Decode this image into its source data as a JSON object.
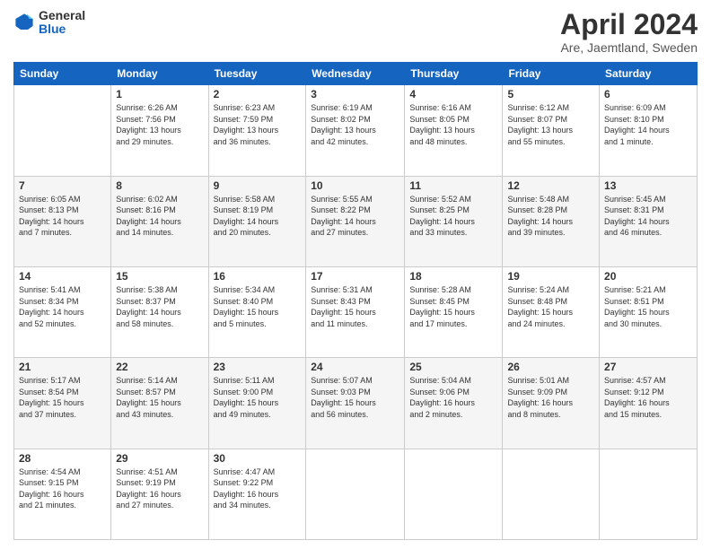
{
  "header": {
    "logo_general": "General",
    "logo_blue": "Blue",
    "month_title": "April 2024",
    "location": "Are, Jaemtland, Sweden"
  },
  "days_of_week": [
    "Sunday",
    "Monday",
    "Tuesday",
    "Wednesday",
    "Thursday",
    "Friday",
    "Saturday"
  ],
  "weeks": [
    [
      {
        "day": "",
        "info": ""
      },
      {
        "day": "1",
        "info": "Sunrise: 6:26 AM\nSunset: 7:56 PM\nDaylight: 13 hours\nand 29 minutes."
      },
      {
        "day": "2",
        "info": "Sunrise: 6:23 AM\nSunset: 7:59 PM\nDaylight: 13 hours\nand 36 minutes."
      },
      {
        "day": "3",
        "info": "Sunrise: 6:19 AM\nSunset: 8:02 PM\nDaylight: 13 hours\nand 42 minutes."
      },
      {
        "day": "4",
        "info": "Sunrise: 6:16 AM\nSunset: 8:05 PM\nDaylight: 13 hours\nand 48 minutes."
      },
      {
        "day": "5",
        "info": "Sunrise: 6:12 AM\nSunset: 8:07 PM\nDaylight: 13 hours\nand 55 minutes."
      },
      {
        "day": "6",
        "info": "Sunrise: 6:09 AM\nSunset: 8:10 PM\nDaylight: 14 hours\nand 1 minute."
      }
    ],
    [
      {
        "day": "7",
        "info": "Sunrise: 6:05 AM\nSunset: 8:13 PM\nDaylight: 14 hours\nand 7 minutes."
      },
      {
        "day": "8",
        "info": "Sunrise: 6:02 AM\nSunset: 8:16 PM\nDaylight: 14 hours\nand 14 minutes."
      },
      {
        "day": "9",
        "info": "Sunrise: 5:58 AM\nSunset: 8:19 PM\nDaylight: 14 hours\nand 20 minutes."
      },
      {
        "day": "10",
        "info": "Sunrise: 5:55 AM\nSunset: 8:22 PM\nDaylight: 14 hours\nand 27 minutes."
      },
      {
        "day": "11",
        "info": "Sunrise: 5:52 AM\nSunset: 8:25 PM\nDaylight: 14 hours\nand 33 minutes."
      },
      {
        "day": "12",
        "info": "Sunrise: 5:48 AM\nSunset: 8:28 PM\nDaylight: 14 hours\nand 39 minutes."
      },
      {
        "day": "13",
        "info": "Sunrise: 5:45 AM\nSunset: 8:31 PM\nDaylight: 14 hours\nand 46 minutes."
      }
    ],
    [
      {
        "day": "14",
        "info": "Sunrise: 5:41 AM\nSunset: 8:34 PM\nDaylight: 14 hours\nand 52 minutes."
      },
      {
        "day": "15",
        "info": "Sunrise: 5:38 AM\nSunset: 8:37 PM\nDaylight: 14 hours\nand 58 minutes."
      },
      {
        "day": "16",
        "info": "Sunrise: 5:34 AM\nSunset: 8:40 PM\nDaylight: 15 hours\nand 5 minutes."
      },
      {
        "day": "17",
        "info": "Sunrise: 5:31 AM\nSunset: 8:43 PM\nDaylight: 15 hours\nand 11 minutes."
      },
      {
        "day": "18",
        "info": "Sunrise: 5:28 AM\nSunset: 8:45 PM\nDaylight: 15 hours\nand 17 minutes."
      },
      {
        "day": "19",
        "info": "Sunrise: 5:24 AM\nSunset: 8:48 PM\nDaylight: 15 hours\nand 24 minutes."
      },
      {
        "day": "20",
        "info": "Sunrise: 5:21 AM\nSunset: 8:51 PM\nDaylight: 15 hours\nand 30 minutes."
      }
    ],
    [
      {
        "day": "21",
        "info": "Sunrise: 5:17 AM\nSunset: 8:54 PM\nDaylight: 15 hours\nand 37 minutes."
      },
      {
        "day": "22",
        "info": "Sunrise: 5:14 AM\nSunset: 8:57 PM\nDaylight: 15 hours\nand 43 minutes."
      },
      {
        "day": "23",
        "info": "Sunrise: 5:11 AM\nSunset: 9:00 PM\nDaylight: 15 hours\nand 49 minutes."
      },
      {
        "day": "24",
        "info": "Sunrise: 5:07 AM\nSunset: 9:03 PM\nDaylight: 15 hours\nand 56 minutes."
      },
      {
        "day": "25",
        "info": "Sunrise: 5:04 AM\nSunset: 9:06 PM\nDaylight: 16 hours\nand 2 minutes."
      },
      {
        "day": "26",
        "info": "Sunrise: 5:01 AM\nSunset: 9:09 PM\nDaylight: 16 hours\nand 8 minutes."
      },
      {
        "day": "27",
        "info": "Sunrise: 4:57 AM\nSunset: 9:12 PM\nDaylight: 16 hours\nand 15 minutes."
      }
    ],
    [
      {
        "day": "28",
        "info": "Sunrise: 4:54 AM\nSunset: 9:15 PM\nDaylight: 16 hours\nand 21 minutes."
      },
      {
        "day": "29",
        "info": "Sunrise: 4:51 AM\nSunset: 9:19 PM\nDaylight: 16 hours\nand 27 minutes."
      },
      {
        "day": "30",
        "info": "Sunrise: 4:47 AM\nSunset: 9:22 PM\nDaylight: 16 hours\nand 34 minutes."
      },
      {
        "day": "",
        "info": ""
      },
      {
        "day": "",
        "info": ""
      },
      {
        "day": "",
        "info": ""
      },
      {
        "day": "",
        "info": ""
      }
    ]
  ]
}
